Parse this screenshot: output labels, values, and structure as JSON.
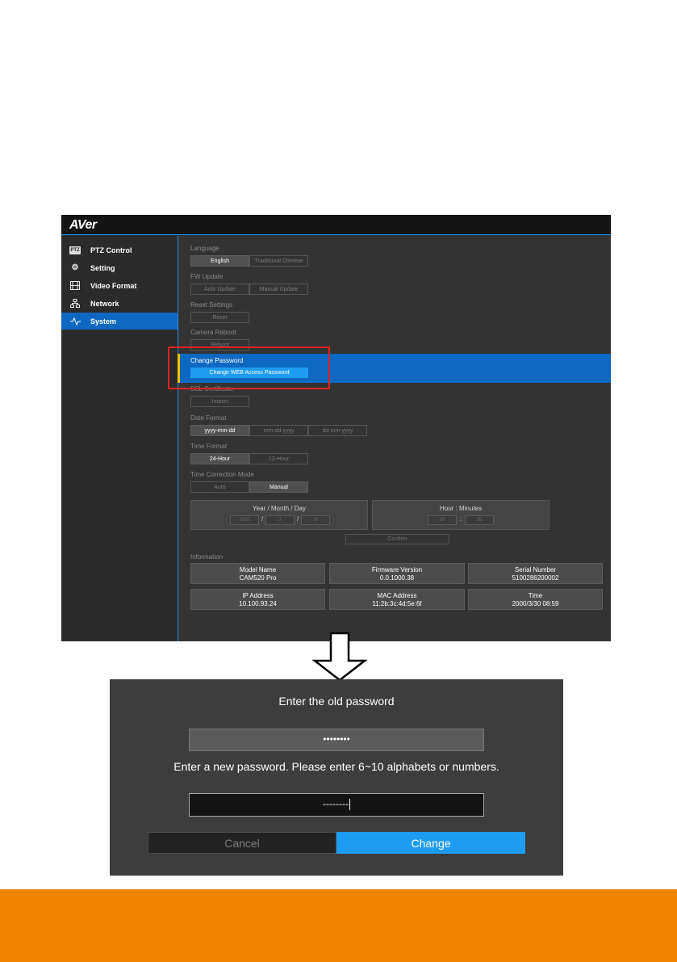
{
  "colors": {
    "accent_blue": "#1d9cf2",
    "active_blue": "#0d68c2",
    "highlight_red": "#e02020",
    "footer_orange": "#f08300",
    "indicator_yellow": "#f4c000"
  },
  "app": {
    "logo": "AVer"
  },
  "sidebar": {
    "items": [
      {
        "label": "PTZ Control",
        "icon": "ptz-icon",
        "badge": "PTZ"
      },
      {
        "label": "Setting",
        "icon": "gear-icon"
      },
      {
        "label": "Video Format",
        "icon": "film-icon"
      },
      {
        "label": "Network",
        "icon": "network-icon"
      },
      {
        "label": "System",
        "icon": "pulse-icon",
        "active": true
      }
    ]
  },
  "system": {
    "language": {
      "label": "Language",
      "options": [
        "English",
        "Traditional Chinese"
      ],
      "selected": "English"
    },
    "fw_update": {
      "label": "FW Update",
      "options": [
        "Auto Update",
        "Manual Update"
      ]
    },
    "reset_settings": {
      "label": "Reset Settings",
      "button": "Reset"
    },
    "camera_reboot": {
      "label": "Camera Reboot",
      "button": "Reboot"
    },
    "change_password": {
      "label": "Change Password",
      "button": "Change WEB Access Password"
    },
    "ssl_cert": {
      "label": "SSL Certificate",
      "button": "Import"
    },
    "date_format": {
      "label": "Date Format",
      "options": [
        "yyyy-mm-dd",
        "mm-dd-yyyy",
        "dd-mm-yyyy"
      ],
      "selected": "yyyy-mm-dd"
    },
    "time_format": {
      "label": "Time Format",
      "options": [
        "24-Hour",
        "12-Hour"
      ],
      "selected": "24-Hour"
    },
    "time_correction": {
      "label": "Time Correction Mode",
      "options": [
        "Auto",
        "Manual"
      ],
      "selected": "Manual"
    },
    "date_box": {
      "title": "Year / Month / Day",
      "fields": [
        "2000",
        "3",
        "30"
      ],
      "sep": "/"
    },
    "time_box": {
      "title": "Hour : Minutes",
      "fields": [
        "08",
        "59"
      ],
      "sep": ":"
    },
    "confirm": "Confirm",
    "information": {
      "label": "Information",
      "cells": [
        {
          "title": "Model Name",
          "value": "CAM520 Pro"
        },
        {
          "title": "Firmware Version",
          "value": "0.0.1000.38"
        },
        {
          "title": "Serial Number",
          "value": "5100286200002"
        },
        {
          "title": "IP Address",
          "value": "10.100.93.24"
        },
        {
          "title": "MAC Address",
          "value": "11:2b:3c:4d:5e:6f"
        },
        {
          "title": "Time",
          "value": "2000/3/30 08:59"
        }
      ]
    }
  },
  "dialog": {
    "old_prompt": "Enter the old password",
    "old_value": "••••••••",
    "new_prompt": "Enter a new password. Please enter 6~10 alphabets or numbers.",
    "new_value": "--------",
    "cancel": "Cancel",
    "change": "Change"
  }
}
